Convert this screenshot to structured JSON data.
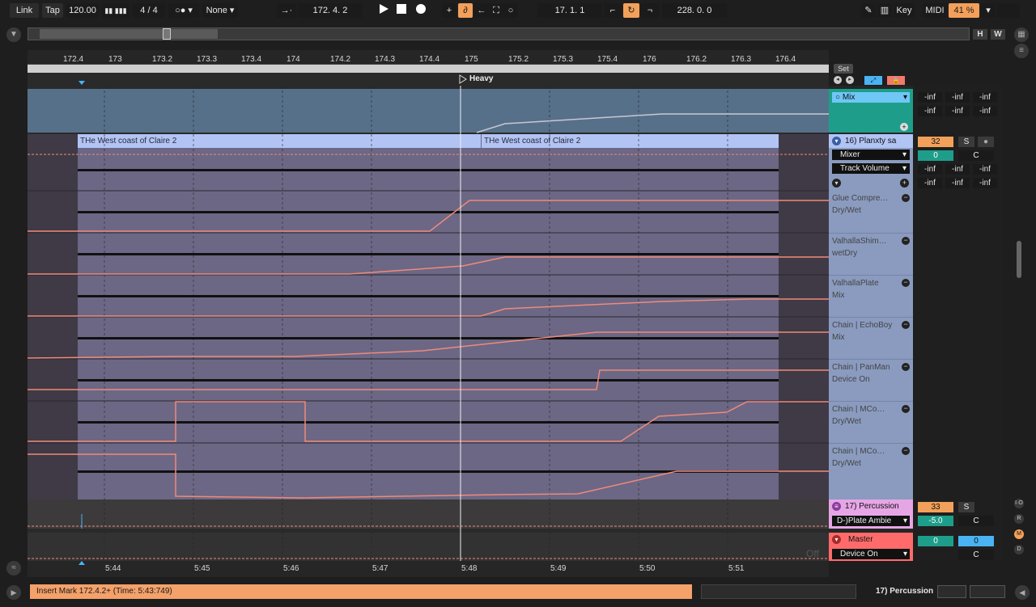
{
  "transport": {
    "link": "Link",
    "tap": "Tap",
    "tempo": "120.00",
    "time_sig": "4 / 4",
    "quantize": "None",
    "position": "172.   4.   2",
    "loop_start": "17.   1.   1",
    "loop_length": "228.   0.   0",
    "key": "Key",
    "midi": "MIDI",
    "cpu": "41 %"
  },
  "overview": {
    "h": "H",
    "w": "W"
  },
  "ruler": {
    "ticks": [
      "172.4",
      "173",
      "173.2",
      "173.3",
      "173.4",
      "174",
      "174.2",
      "174.3",
      "174.4",
      "175",
      "175.2",
      "175.3",
      "175.4",
      "176",
      "176.2",
      "176.3",
      "176.4"
    ]
  },
  "scene": {
    "marker": "Heavy",
    "set_label": "Set"
  },
  "clips": {
    "title_a": "THe West coast of Claire 2",
    "title_b": "THe West coast of Claire 2"
  },
  "group_track": {
    "mix_label": "Mix",
    "sends": [
      "-inf",
      "-inf",
      "-inf",
      "-inf",
      "-inf",
      "-inf"
    ]
  },
  "track16": {
    "name": "16) Planxty sa",
    "device": "Mixer",
    "param": "Track Volume",
    "number": "32",
    "solo": "S",
    "volume": "0",
    "pan": "C",
    "sends": [
      "-inf",
      "-inf",
      "-inf",
      "-inf",
      "-inf",
      "-inf"
    ],
    "lanes": [
      {
        "device": "Glue Compre…",
        "param": "Dry/Wet"
      },
      {
        "device": "ValhallaShim…",
        "param": "wetDry"
      },
      {
        "device": "ValhallaPlate",
        "param": "Mix"
      },
      {
        "device": "Chain | EchoBoy",
        "param": "Mix"
      },
      {
        "device": "Chain | PanMan",
        "param": "Device On"
      },
      {
        "device": "Chain | MCo…",
        "param": "Dry/Wet"
      },
      {
        "device": "Chain | MCo…",
        "param": "Dry/Wet"
      }
    ]
  },
  "track17": {
    "name": "17) Percussion",
    "device": "D-)Plate Ambie",
    "number": "33",
    "solo": "S",
    "volume": "-5.0",
    "pan": "C"
  },
  "master": {
    "name": "Master",
    "param": "Device On",
    "volume": "0",
    "send": "0",
    "pan": "C",
    "off_label": "Off"
  },
  "timeline": {
    "ticks": [
      "5:44",
      "5:45",
      "5:46",
      "5:47",
      "5:48",
      "5:49",
      "5:50",
      "5:51"
    ]
  },
  "status": {
    "message": "Insert Mark 172.4.2+ (Time: 5:43:749)",
    "track": "17) Percussion"
  },
  "side_buttons": [
    "I·O",
    "R",
    "M",
    "D"
  ],
  "colors": {
    "accent": "#f2a05a",
    "automation": "#f08a7a",
    "clip_header": "#b2c4f4",
    "clip_body": "#6c6785",
    "group": "#1e9e8a",
    "track16": "#8a9bbf",
    "percussion": "#e6a6e6",
    "master": "#ff6b6b",
    "status": "#f4a16a"
  }
}
